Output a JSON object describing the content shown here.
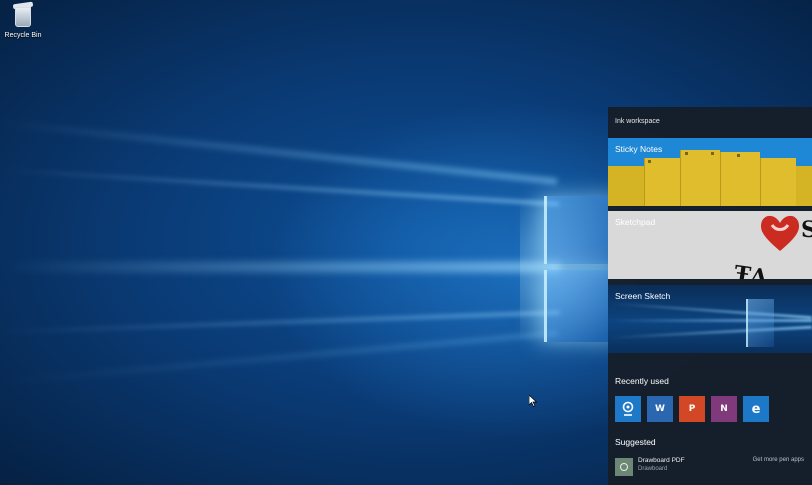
{
  "desktop": {
    "recycle_bin_label": "Recycle Bin"
  },
  "ink_workspace": {
    "title": "Ink workspace",
    "tiles": [
      {
        "label": "Sticky Notes"
      },
      {
        "label": "Sketchpad"
      },
      {
        "label": "Screen Sketch"
      }
    ],
    "recently_used": {
      "heading": "Recently used",
      "apps": [
        {
          "name": "maps-app-icon",
          "glyph": "◎",
          "color": "#1f79c9"
        },
        {
          "name": "word-icon",
          "glyph": "W",
          "color": "#2b66b1"
        },
        {
          "name": "powerpoint-icon",
          "glyph": "P",
          "color": "#d24726"
        },
        {
          "name": "onenote-icon",
          "glyph": "N",
          "color": "#80397b"
        },
        {
          "name": "edge-icon",
          "glyph": "e",
          "color": "#1e78c8"
        }
      ]
    },
    "suggested": {
      "heading": "Suggested",
      "item_name": "Drawboard PDF",
      "item_publisher": "Drawboard",
      "more_link": "Get more pen apps"
    }
  },
  "colors": {
    "panel_bg": "#161e2a",
    "sticky_yellow": "#e0bd2c",
    "accent_blue": "#1e88d6"
  }
}
